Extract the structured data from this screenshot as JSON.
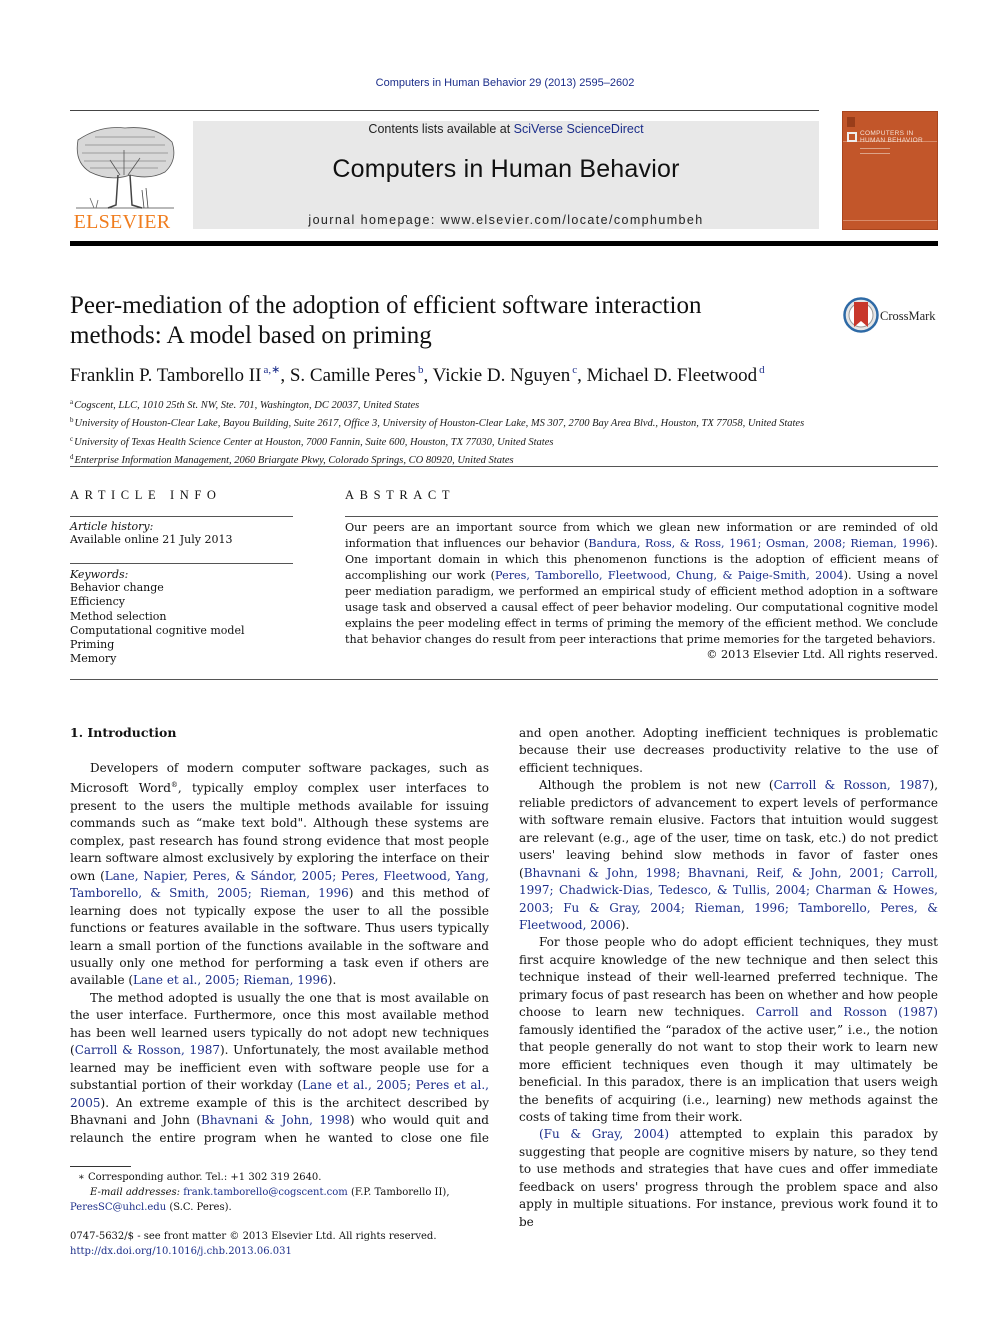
{
  "header": {
    "journal_reference": "Computers in Human Behavior 29 (2013) 2595–2602",
    "contents_prefix": "Contents lists available at ",
    "contents_link": "SciVerse ScienceDirect",
    "journal_title": "Computers in Human Behavior",
    "homepage": "journal homepage: www.elsevier.com/locate/comphumbeh",
    "publisher_logo_text": "ELSEVIER",
    "cover": {
      "title_line1": "COMPUTERS IN",
      "title_line2": "HUMAN BEHAVIOR",
      "color": "#c2562a"
    },
    "brand_color": "#f07d1e",
    "link_color": "#1c2e8a"
  },
  "article": {
    "title_line1": "Peer-mediation of the adoption of efficient software interaction",
    "title_line2": "methods: A model based on priming",
    "crossmark_label": "CrossMark",
    "authors": [
      {
        "name": "Franklin P. Tamborello II",
        "sup": "a,∗",
        "sep": ", "
      },
      {
        "name": "S. Camille Peres",
        "sup": "b",
        "sep": ", "
      },
      {
        "name": "Vickie D. Nguyen",
        "sup": "c",
        "sep": ", "
      },
      {
        "name": "Michael D. Fleetwood",
        "sup": "d",
        "sep": ""
      }
    ],
    "affiliations": [
      {
        "sup": "a",
        "text": "Cogscent, LLC, 1010 25th St. NW, Ste. 701, Washington, DC 20037, United States"
      },
      {
        "sup": "b",
        "text": "University of Houston-Clear Lake, Bayou Building, Suite 2617, Office 3, University of Houston-Clear Lake, MS 307, 2700 Bay Area Blvd., Houston, TX 77058, United States"
      },
      {
        "sup": "c",
        "text": "University of Texas Health Science Center at Houston, 7000 Fannin, Suite 600, Houston, TX 77030, United States"
      },
      {
        "sup": "d",
        "text": "Enterprise Information Management, 2060 Briargate Pkwy, Colorado Springs, CO 80920, United States"
      }
    ]
  },
  "article_info": {
    "heading": "ARTICLE INFO",
    "history_label": "Article history:",
    "history_value": "Available online 21 July 2013",
    "keywords_label": "Keywords:",
    "keywords": [
      "Behavior change",
      "Efficiency",
      "Method selection",
      "Computational cognitive model",
      "Priming",
      "Memory"
    ]
  },
  "abstract": {
    "heading": "ABSTRACT",
    "t1": "Our peers are an important source from which we glean new information or are reminded of old information that influences our behavior (",
    "c1": "Bandura, Ross, & Ross, 1961; Osman, 2008; Rieman, 1996",
    "t2": "). One important domain in which this phenomenon functions is the adoption of efficient means of accomplishing our work (",
    "c2": "Peres, Tamborello, Fleetwood, Chung, & Paige-Smith, 2004",
    "t3": "). Using a novel peer mediation paradigm, we performed an empirical study of efficient method adoption in a software usage task and observed a causal effect of peer behavior modeling. Our computational cognitive model explains the peer modeling effect in terms of priming the memory of the efficient method. We conclude that behavior changes do result from peer interactions that prime memories for the targeted behaviors.",
    "copyright": "© 2013 Elsevier Ltd. All rights reserved."
  },
  "body": {
    "section_heading": "1. Introduction",
    "p1": {
      "t1": "Developers of modern computer software packages, such as Microsoft Word",
      "reg": "®",
      "t2": ", typically employ complex user interfaces to present to the users the multiple methods available for issuing commands such as “make text bold\". Although these systems are complex, past research has found strong evidence that most people learn software almost exclusively by exploring the interface on their own (",
      "c1": "Lane, Napier, Peres, & Sándor, 2005; Peres, Fleetwood, Yang, Tamborello, & Smith, 2005; Rieman, 1996",
      "t3": ") and this method of learning does not typically expose the user to all the possible functions or features available in the software. Thus users typically learn a small portion of the functions available in the software and usually only one method for performing a task even if others are available (",
      "c2": "Lane et al., 2005; Rieman, 1996",
      "t4": ")."
    },
    "p2": {
      "t1": "The method adopted is usually the one that is most available on the user interface. Furthermore, once this most available method has been well learned users typically do not adopt new techniques (",
      "c1": "Carroll & Rosson, 1987",
      "t2": "). Unfortunately, the most available method learned may be inefficient even with software people use for a substantial portion of their workday (",
      "c2": "Lane et al., 2005; Peres et al., 2005",
      "t3": "). An extreme example of this is the architect described by Bhavnani and John (",
      "c3": "Bhavnani & John, 1998",
      "t4": ") who would quit and relaunch the entire program when he wanted to close one file and open another. Adopting inefficient techniques is problematic because their use decreases productivity relative to the use of efficient techniques."
    },
    "p3": {
      "t1": "Although the problem is not new (",
      "c1": "Carroll & Rosson, 1987",
      "t2": "), reliable predictors of advancement to expert levels of performance with software remain elusive. Factors that intuition would suggest are relevant (e.g., age of the user, time on task, etc.) do not predict users' leaving behind slow methods in favor of faster ones (",
      "c2": "Bhavnani & John, 1998; Bhavnani, Reif, & John, 2001; Carroll, 1997; Chadwick-Dias, Tedesco, & Tullis, 2004; Charman & Howes, 2003; Fu & Gray, 2004; Rieman, 1996; Tamborello, Peres, & Fleetwood, 2006",
      "t3": ")."
    },
    "p4": {
      "t1": "For those people who do adopt efficient techniques, they must first acquire knowledge of the new technique and then select this technique instead of their well-learned preferred technique. The primary focus of past research has been on whether and how people choose to learn new techniques. ",
      "c1": "Carroll and Rosson (1987)",
      "t2": " famously identified the “paradox of the active user,” i.e., the notion that people generally do not want to stop their work to learn new more efficient techniques even though it may ultimately be beneficial. In this paradox, there is an implication that users weigh the benefits of acquiring (i.e., learning) new methods against the costs of taking time from their work."
    },
    "p5": {
      "c1": "(Fu & Gray, 2004)",
      "t1": " attempted to explain this paradox by suggesting that people are cognitive misers by nature, so they tend to use methods and strategies that have cues and offer immediate feedback on users' progress through the problem space and also apply in multiple situations. For instance, previous work found it to be"
    }
  },
  "footnotes": {
    "corresponding": "∗  Corresponding author. Tel.: +1 302 319 2640.",
    "email_label": "E-mail addresses:",
    "email1": "frank.tamborello@cogscent.com",
    "email1_owner": " (F.P. Tamborello II), ",
    "email2": "PeresSC@uhcl.edu",
    "email2_owner": " (S.C. Peres).",
    "front_matter": "0747-5632/$ - see front matter © 2013 Elsevier Ltd. All rights reserved.",
    "doi": "http://dx.doi.org/10.1016/j.chb.2013.06.031"
  }
}
